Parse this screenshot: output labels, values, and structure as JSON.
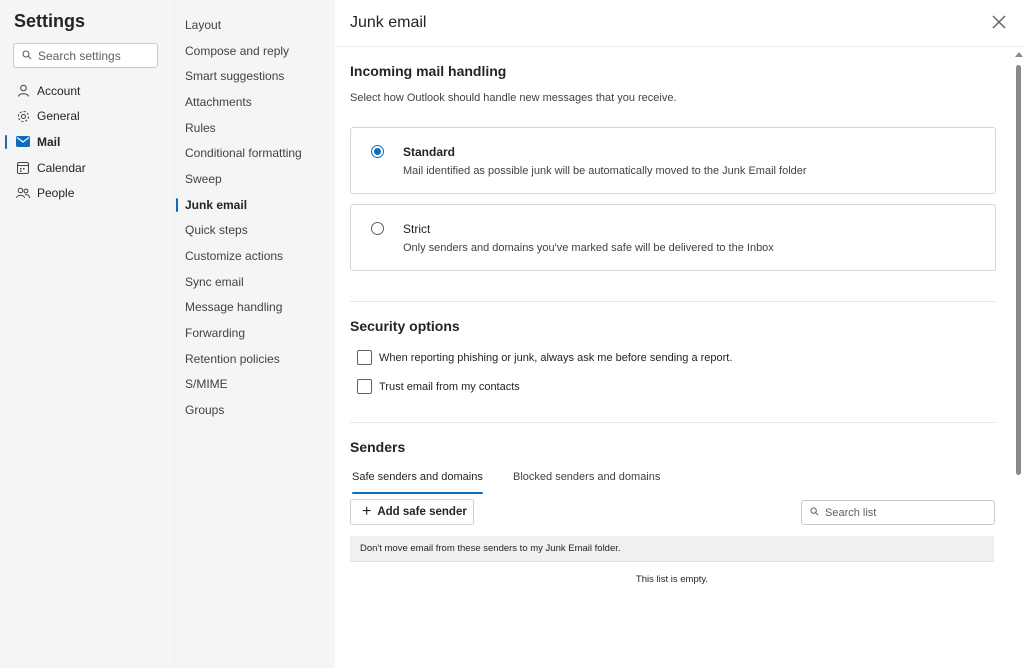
{
  "nav": {
    "title": "Settings",
    "search_placeholder": "Search settings",
    "items": [
      {
        "label": "Account",
        "icon": "person-icon"
      },
      {
        "label": "General",
        "icon": "gear-icon"
      },
      {
        "label": "Mail",
        "icon": "mail-icon",
        "active": true
      },
      {
        "label": "Calendar",
        "icon": "calendar-icon"
      },
      {
        "label": "People",
        "icon": "people-icon"
      }
    ]
  },
  "subnav": {
    "items": [
      "Layout",
      "Compose and reply",
      "Smart suggestions",
      "Attachments",
      "Rules",
      "Conditional formatting",
      "Sweep",
      "Junk email",
      "Quick steps",
      "Customize actions",
      "Sync email",
      "Message handling",
      "Forwarding",
      "Retention policies",
      "S/MIME",
      "Groups"
    ],
    "active": "Junk email"
  },
  "main": {
    "title": "Junk email",
    "incoming": {
      "heading": "Incoming mail handling",
      "description": "Select how Outlook should handle new messages that you receive.",
      "standard": {
        "label": "Standard",
        "description": "Mail identified as possible junk will be automatically moved to the Junk Email folder",
        "selected": true
      },
      "strict": {
        "label": "Strict",
        "description": "Only senders and domains you've marked safe will be delivered to the Inbox",
        "selected": false
      }
    },
    "security": {
      "heading": "Security options",
      "phishing_label": "When reporting phishing or junk, always ask me before sending a report.",
      "trust_label": "Trust email from my contacts"
    },
    "senders": {
      "heading": "Senders",
      "tab_safe": "Safe senders and domains",
      "tab_blocked": "Blocked senders and domains",
      "add_button": "Add safe sender",
      "search_placeholder": "Search list",
      "list_header": "Don't move email from these senders to my Junk Email folder.",
      "empty_text": "This list is empty."
    }
  },
  "colors": {
    "accent": "#0f6cbd",
    "nav_bg": "#f5f5f5"
  }
}
